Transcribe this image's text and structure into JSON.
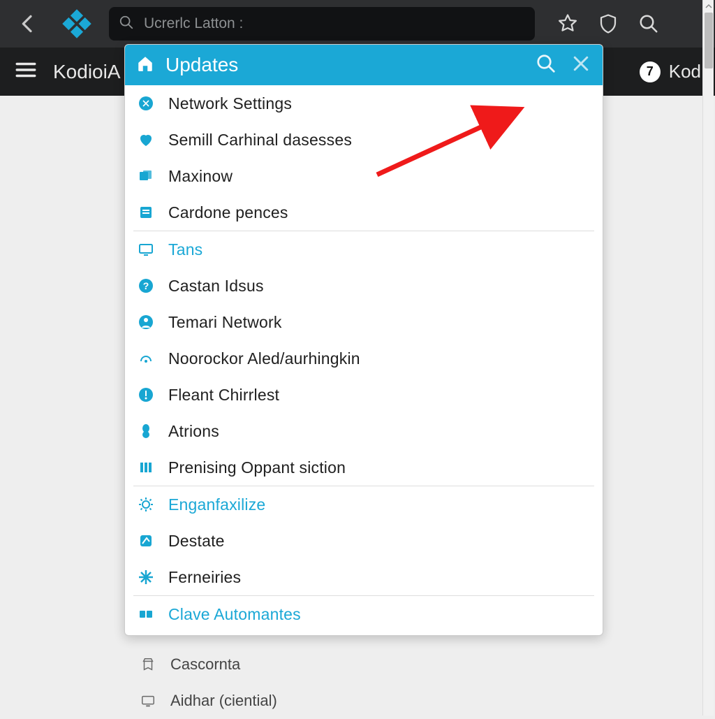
{
  "topbar": {
    "url_text": "Ucrerlc Latton :"
  },
  "secondbar": {
    "app_title": "KodioiA",
    "badge_count": "7",
    "badge_text": "Kod"
  },
  "dropdown": {
    "header_title": "Updates",
    "items": [
      {
        "label": "Network Settings",
        "iconColor": "#18a6d2",
        "light": false,
        "sep": false
      },
      {
        "label": "Semill Carhinal dasesses",
        "iconColor": "#18a6d2",
        "light": false,
        "sep": false
      },
      {
        "label": "Maxinow",
        "iconColor": "#18a6d2",
        "light": false,
        "sep": false
      },
      {
        "label": "Cardone pences",
        "iconColor": "#18a6d2",
        "light": false,
        "sep": false
      },
      {
        "label": "Tans",
        "iconColor": "#18a6d2",
        "light": true,
        "sep": true
      },
      {
        "label": "Castan Idsus",
        "iconColor": "#18a6d2",
        "light": false,
        "sep": false
      },
      {
        "label": "Temari Network",
        "iconColor": "#18a6d2",
        "light": false,
        "sep": false
      },
      {
        "label": "Noorockor Aled/aurhingkin",
        "iconColor": "#18a6d2",
        "light": false,
        "sep": false
      },
      {
        "label": "Fleant Chirrlest",
        "iconColor": "#18a6d2",
        "light": false,
        "sep": false
      },
      {
        "label": "Atrions",
        "iconColor": "#18a6d2",
        "light": false,
        "sep": false
      },
      {
        "label": "Prenising Oppant siction",
        "iconColor": "#18a6d2",
        "light": false,
        "sep": false
      },
      {
        "label": "Enganfaxilize",
        "iconColor": "#18a6d2",
        "light": true,
        "sep": true
      },
      {
        "label": "Destate",
        "iconColor": "#18a6d2",
        "light": false,
        "sep": false
      },
      {
        "label": "Ferneiries",
        "iconColor": "#18a6d2",
        "light": false,
        "sep": false
      },
      {
        "label": "Clave Automantes",
        "iconColor": "#18a6d2",
        "light": true,
        "sep": true
      }
    ]
  },
  "below": {
    "items": [
      {
        "label": "Cascornta"
      },
      {
        "label": "Aidhar (ciential)"
      }
    ]
  },
  "colors": {
    "accent": "#1ba8d6",
    "darkbar": "#2e2f31",
    "darkerbar": "#1d1e1f"
  }
}
